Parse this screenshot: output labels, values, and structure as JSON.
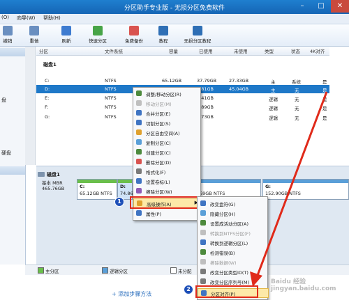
{
  "window": {
    "title": "分区助手专业版 - 无损分区免费软件"
  },
  "menubar": {
    "items": [
      "(O)",
      "向导(W)",
      "帮助(H)"
    ]
  },
  "toolbar": {
    "items": [
      "撤销",
      "重做",
      "刷新",
      "快速分区",
      "免费备份",
      "教程",
      "无损分区教程"
    ]
  },
  "leftpanel": {
    "labels": [
      "盘",
      "硬盘"
    ]
  },
  "table": {
    "headers": [
      "分区",
      "文件系统",
      "容量",
      "已使用",
      "未使用",
      "类型",
      "状态",
      "4K对齐"
    ],
    "disk_label": "磁盘1",
    "rows": [
      {
        "part": "C:",
        "fs": "NTFS",
        "cap": "65.12GB",
        "used": "37.79GB",
        "free": "27.33GB",
        "type": "主",
        "status": "系统",
        "align": "是"
      },
      {
        "part": "D:",
        "fs": "NTFS",
        "cap": "",
        "used": "9.81GB",
        "free": "45.04GB",
        "type": "主",
        "status": "无",
        "align": "是"
      },
      {
        "part": "E:",
        "fs": "NTFS",
        "cap": "",
        "used": "9.41GB",
        "free": "",
        "type": "逻辑",
        "status": "无",
        "align": "是"
      },
      {
        "part": "F:",
        "fs": "NTFS",
        "cap": "",
        "used": "6.89GB",
        "free": "",
        "type": "逻辑",
        "status": "无",
        "align": "是"
      },
      {
        "part": "G:",
        "fs": "NTFS",
        "cap": "",
        "used": "6.73GB",
        "free": "",
        "type": "逻辑",
        "status": "无",
        "align": "是"
      }
    ]
  },
  "diskmap": {
    "disk_name": "磁盘1",
    "disk_type": "基本 MBR",
    "disk_size": "465.76GB",
    "segments": [
      {
        "name": "C:",
        "info": "65.12GB NTFS"
      },
      {
        "name": "D:",
        "info": "74.86"
      },
      {
        "name": "",
        "info": "69GB NTFS"
      },
      {
        "name": "G:",
        "info": "152.90GB NTFS"
      }
    ]
  },
  "context_menu_1": {
    "items": [
      {
        "label": "调整/移动分区(R)",
        "disabled": false
      },
      {
        "label": "移动分区(M)",
        "disabled": true
      },
      {
        "label": "合并分区(E)",
        "disabled": false
      },
      {
        "label": "切割分区(S)",
        "disabled": false
      },
      {
        "label": "分区自由空间(A)",
        "disabled": false
      },
      {
        "label": "复制分区(C)",
        "disabled": false
      },
      {
        "label": "创建分区(C)",
        "disabled": false
      },
      {
        "label": "删除分区(D)",
        "disabled": false
      },
      {
        "label": "格式化(F)",
        "disabled": false
      },
      {
        "label": "设置卷标(L)",
        "disabled": false
      },
      {
        "label": "擦除分区(W)",
        "disabled": false
      },
      {
        "label": "高级操作(A)",
        "disabled": false
      },
      {
        "label": "属性(P)",
        "disabled": false
      }
    ]
  },
  "context_menu_2": {
    "items": [
      {
        "label": "改变盘符(G)",
        "disabled": false
      },
      {
        "label": "隐藏分区(H)",
        "disabled": false
      },
      {
        "label": "设置成活动分区(A)",
        "disabled": false
      },
      {
        "label": "转换到NTFS分区(F)",
        "disabled": true
      },
      {
        "label": "转换到逻辑分区(L)",
        "disabled": false
      },
      {
        "label": "检测错误(B)",
        "disabled": false
      },
      {
        "label": "擦除数据(W)",
        "disabled": true
      },
      {
        "label": "改变分区类型ID(T)",
        "disabled": false
      },
      {
        "label": "改变分区序列号(M)",
        "disabled": false
      },
      {
        "label": "分区对齐(P)",
        "disabled": false
      }
    ]
  },
  "annotations": {
    "badge1": "1",
    "badge2": "2"
  },
  "statusbar": {
    "legend": [
      "主分区",
      "逻辑分区",
      "未分配"
    ]
  },
  "below": {
    "link_text": "+ 添加步骤方法"
  },
  "watermark": "Baidu 经验 jingyan.baidu.com",
  "colors": {
    "titlebar": "#1565b5",
    "selection": "#1e78c8",
    "highlight": "#fde9a8",
    "annotation_red": "#e02a1a",
    "badge_blue": "#1d4fb8"
  }
}
